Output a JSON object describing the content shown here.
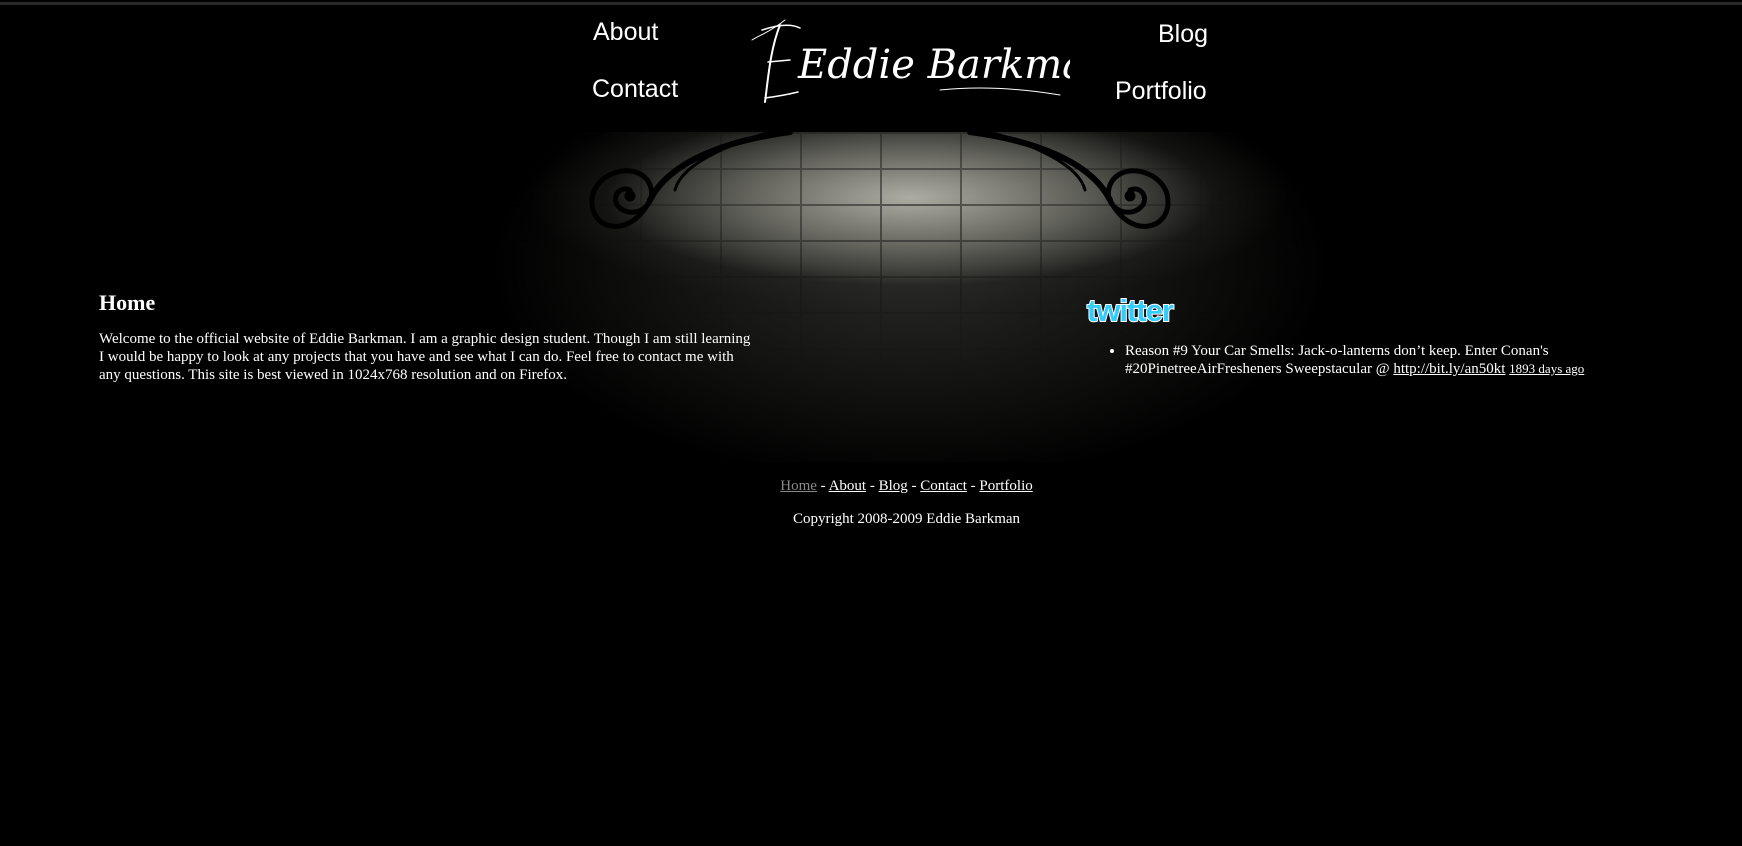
{
  "header": {
    "logo_text": "Eddie Barkman",
    "nav": {
      "about": "About",
      "contact": "Contact",
      "blog": "Blog",
      "portfolio": "Portfolio"
    }
  },
  "main": {
    "title": "Home",
    "body": "Welcome to the official website of Eddie Barkman. I am a graphic design student. Though I am still learning I would be happy to look at any projects that you have and see what I can do. Feel free to contact me with any questions. This site is best viewed in 1024x768 resolution and on Firefox."
  },
  "twitter": {
    "logo_text": "twitter",
    "tweets": [
      {
        "text": "Reason #9 Your Car Smells: Jack-o-lanterns don’t keep. Enter Conan's #20PinetreeAirFresheners Sweepstacular @ ",
        "link": "http://bit.ly/an50kt",
        "ago": "1893 days ago"
      }
    ]
  },
  "footer": {
    "links": {
      "home": "Home",
      "about": "About",
      "blog": "Blog",
      "contact": "Contact",
      "portfolio": "Portfolio"
    },
    "separator": " - ",
    "copyright": "Copyright 2008-2009 Eddie Barkman"
  },
  "colors": {
    "background": "#000000",
    "text": "#ffffff",
    "current_link": "#888888",
    "twitter_blue": "#33ccff"
  }
}
